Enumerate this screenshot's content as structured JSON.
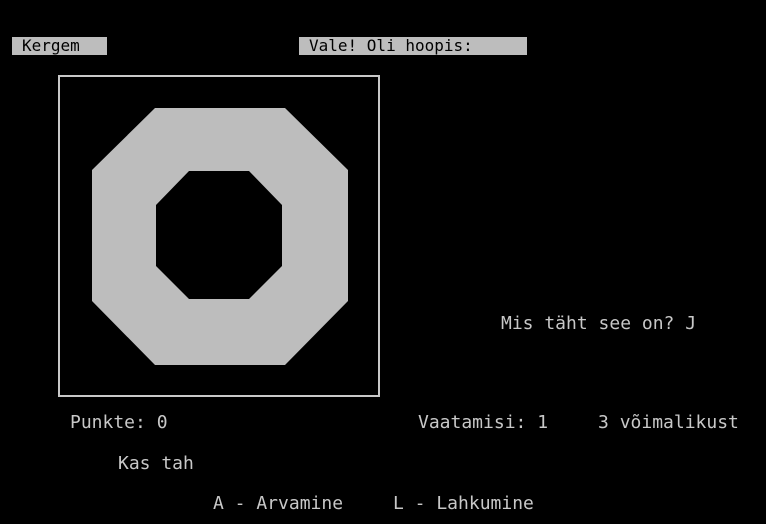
{
  "header": {
    "level_label": "Kergem",
    "status_label": "Vale! Oli hoopis:"
  },
  "puzzle": {
    "shape_color": "#bdbdbd",
    "shape_icon": "letter-o-octagon-shape",
    "question_text": "Mis täht see on?",
    "answer": "J"
  },
  "stats": {
    "points_label": "Punkte:",
    "points_value": "0",
    "views_label": "Vaatamisi:",
    "views_value": "1",
    "possible_value": "3",
    "possible_label": "võimalikust"
  },
  "footer": {
    "prompt": "Kas tah",
    "option_a": "A - Arvamine",
    "option_l": "L - Lahkumine"
  },
  "colors": {
    "background": "#000000",
    "foreground": "#c8c8c8",
    "inverse_bg": "#bdbdbd"
  }
}
